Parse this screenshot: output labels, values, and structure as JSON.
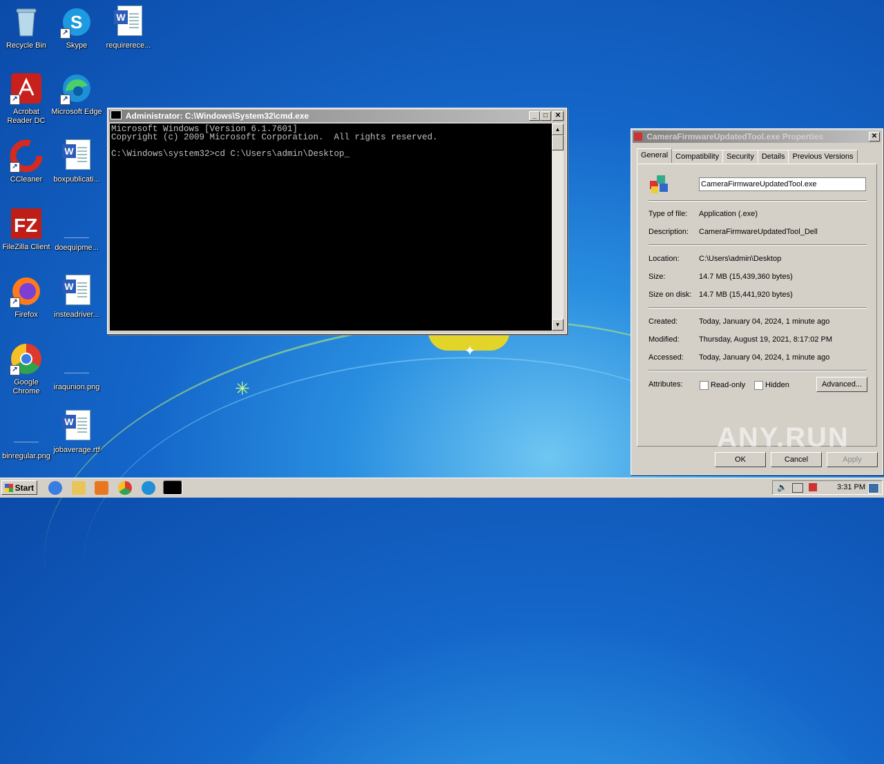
{
  "desktop": {
    "icons": [
      {
        "label": "Recycle Bin"
      },
      {
        "label": "Skype"
      },
      {
        "label": "requirerece..."
      },
      {
        "label": "Acrobat Reader DC"
      },
      {
        "label": "Microsoft Edge"
      },
      {
        "label": "CCleaner"
      },
      {
        "label": "boxpublicati..."
      },
      {
        "label": "FileZilla Client"
      },
      {
        "label": "doequipme..."
      },
      {
        "label": "Firefox"
      },
      {
        "label": "insteadriver..."
      },
      {
        "label": "Google Chrome"
      },
      {
        "label": "iraqunion.png"
      },
      {
        "label": "binregular.png"
      },
      {
        "label": "jobaverage.rtf"
      }
    ]
  },
  "cmd": {
    "title": "Administrator: C:\\Windows\\System32\\cmd.exe",
    "console_text": "Microsoft Windows [Version 6.1.7601]\nCopyright (c) 2009 Microsoft Corporation.  All rights reserved.\n\nC:\\Windows\\system32>cd C:\\Users\\admin\\Desktop_",
    "min_glyph": "_",
    "max_glyph": "□",
    "close_glyph": "✕"
  },
  "props": {
    "title": "CameraFirmwareUpdatedTool.exe Properties",
    "close_glyph": "✕",
    "tabs": [
      "General",
      "Compatibility",
      "Security",
      "Details",
      "Previous Versions"
    ],
    "filename": "CameraFirmwareUpdatedTool.exe",
    "type_label": "Type of file:",
    "type_value": "Application (.exe)",
    "desc_label": "Description:",
    "desc_value": "CameraFirmwareUpdatedTool_Dell",
    "loc_label": "Location:",
    "loc_value": "C:\\Users\\admin\\Desktop",
    "size_label": "Size:",
    "size_value": "14.7 MB (15,439,360 bytes)",
    "disk_label": "Size on disk:",
    "disk_value": "14.7 MB (15,441,920 bytes)",
    "created_label": "Created:",
    "created_value": "Today, January 04, 2024, 1 minute ago",
    "modified_label": "Modified:",
    "modified_value": "Thursday, August 19, 2021, 8:17:02 PM",
    "accessed_label": "Accessed:",
    "accessed_value": "Today, January 04, 2024, 1 minute ago",
    "attr_label": "Attributes:",
    "readonly_label": "Read-only",
    "hidden_label": "Hidden",
    "advanced_label": "Advanced...",
    "ok_label": "OK",
    "cancel_label": "Cancel",
    "apply_label": "Apply"
  },
  "watermark": "ANY.RUN",
  "taskbar": {
    "start_label": "Start",
    "clock": "3:31 PM"
  }
}
